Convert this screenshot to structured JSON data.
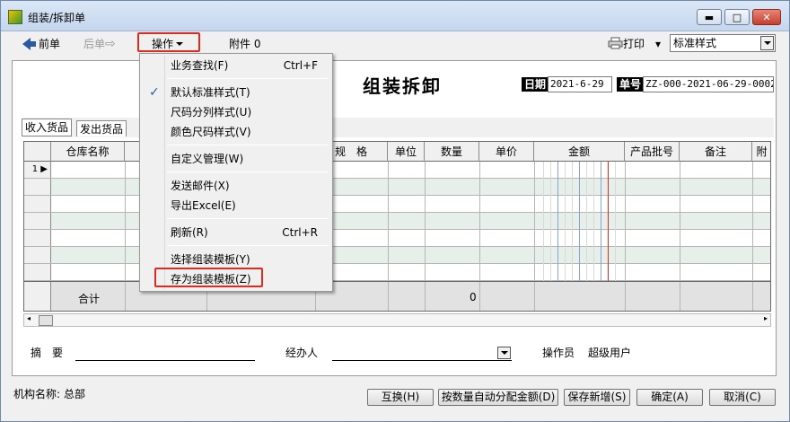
{
  "window": {
    "title": "组装/拆卸单",
    "min_glyph": "▬",
    "max_glyph": "□",
    "close_glyph": "✕"
  },
  "toolbar": {
    "prev_label": "前单",
    "next_label": "后单",
    "next_arrow": "⇨",
    "operation_label": "操作",
    "attachment_label": "附件",
    "attachment_count": "0",
    "print_label": "打印",
    "print_arrow": "▾",
    "style_value": "标准样式",
    "print_icon": "printer-icon"
  },
  "form": {
    "title": "组装拆卸",
    "date_label": "日期",
    "date_value": "2021-6-29",
    "number_label": "单号",
    "number_value": "ZZ-000-2021-06-29-0002"
  },
  "tabs": [
    "收入货品",
    "发出货品"
  ],
  "grid": {
    "columns": [
      "仓库名称",
      "规　格",
      "单位",
      "数量",
      "单价",
      "金额",
      "产品批号",
      "备注",
      "附"
    ],
    "first_row_index": "1",
    "total_label": "合计",
    "total_quantity": "0"
  },
  "footer": {
    "summary_label": "摘　要",
    "handler_label": "经办人",
    "operator_label": "操作员",
    "operator_value": "超级用户"
  },
  "status": {
    "org_label": "机构名称:",
    "org_value": "总部"
  },
  "buttons": {
    "swap": "互换(H)",
    "auto_allocate": "按数量自动分配金额(D)",
    "save_add": "保存新增(S)",
    "ok": "确定(A)",
    "cancel": "取消(C)"
  },
  "menu": {
    "items": [
      {
        "label": "业务查找(F)",
        "shortcut": "Ctrl+F"
      },
      {
        "label": "默认标准样式(T)",
        "checked": true
      },
      {
        "label": "尺码分列样式(U)"
      },
      {
        "label": "颜色尺码样式(V)"
      },
      {
        "label": "自定义管理(W)"
      },
      {
        "label": "发送邮件(X)"
      },
      {
        "label": "导出Excel(E)"
      },
      {
        "label": "刷新(R)",
        "shortcut": "Ctrl+R"
      },
      {
        "label": "选择组装模板(Y)"
      },
      {
        "label": "存为组装模板(Z)"
      }
    ]
  },
  "colors": {
    "highlight": "#e02a20",
    "accent_blue": "#2b5a9f",
    "row_alt": "#e6efe9"
  }
}
